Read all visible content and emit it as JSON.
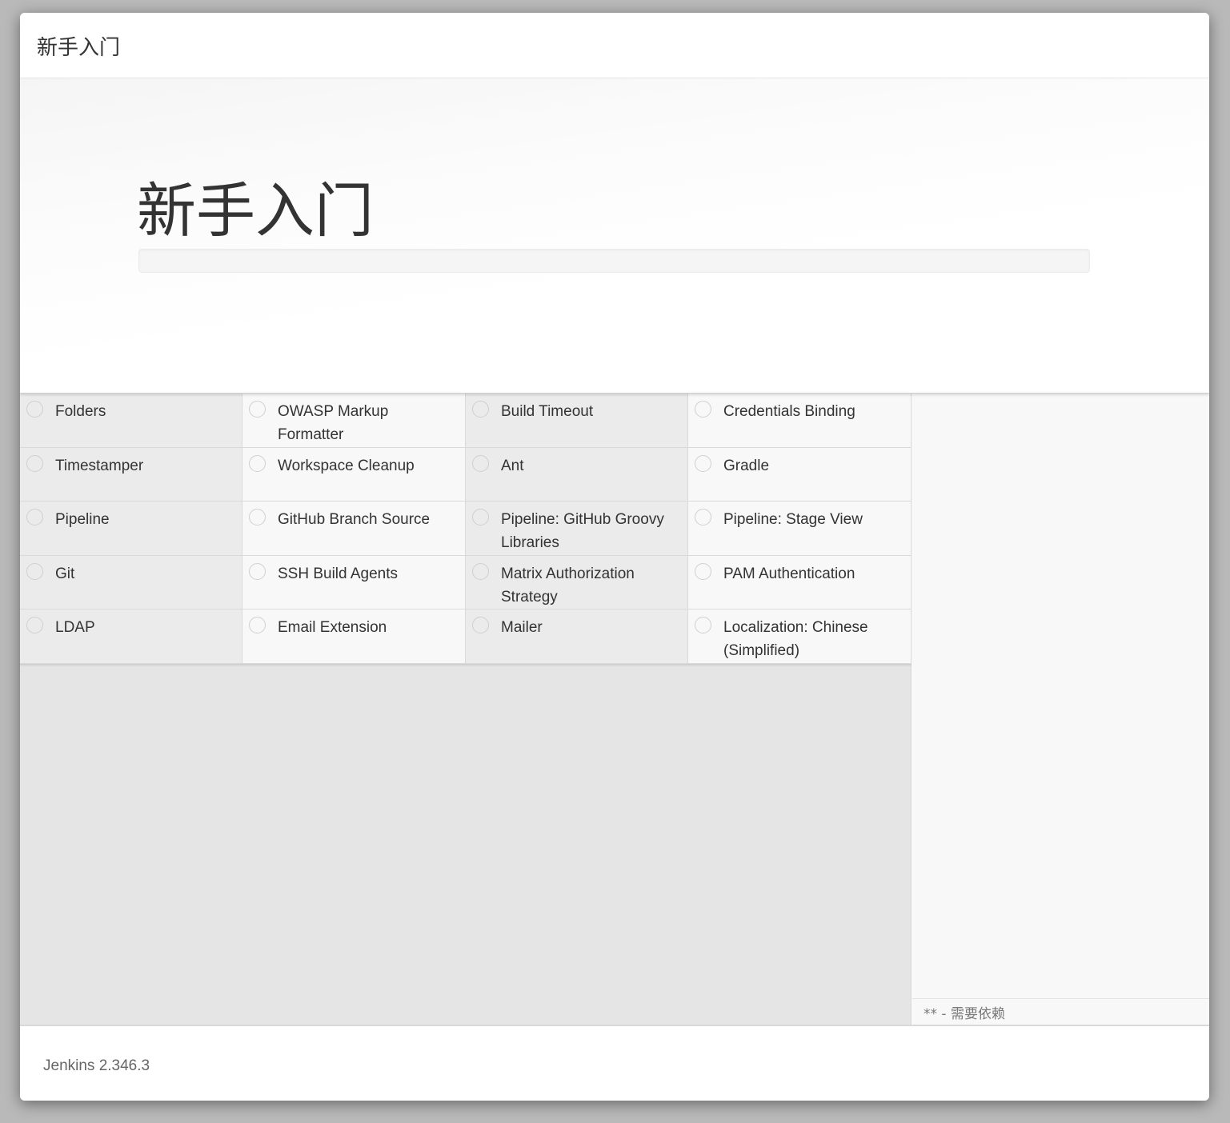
{
  "dialog": {
    "title": "新手入门"
  },
  "hero": {
    "title": "新手入门",
    "progress_percent": 0
  },
  "plugins": [
    {
      "label": "Folders",
      "shade": "a"
    },
    {
      "label": "OWASP Markup Formatter",
      "shade": "b"
    },
    {
      "label": "Build Timeout",
      "shade": "a"
    },
    {
      "label": "Credentials Binding",
      "shade": "b"
    },
    {
      "label": "Timestamper",
      "shade": "a"
    },
    {
      "label": "Workspace Cleanup",
      "shade": "b"
    },
    {
      "label": "Ant",
      "shade": "a"
    },
    {
      "label": "Gradle",
      "shade": "b"
    },
    {
      "label": "Pipeline",
      "shade": "a"
    },
    {
      "label": "GitHub Branch Source",
      "shade": "b"
    },
    {
      "label": "Pipeline: GitHub Groovy Libraries",
      "shade": "a"
    },
    {
      "label": "Pipeline: Stage View",
      "shade": "b"
    },
    {
      "label": "Git",
      "shade": "a"
    },
    {
      "label": "SSH Build Agents",
      "shade": "b"
    },
    {
      "label": "Matrix Authorization Strategy",
      "shade": "a"
    },
    {
      "label": "PAM Authentication",
      "shade": "b"
    },
    {
      "label": "LDAP",
      "shade": "a"
    },
    {
      "label": "Email Extension",
      "shade": "b"
    },
    {
      "label": "Mailer",
      "shade": "a"
    },
    {
      "label": "Localization: Chinese (Simplified)",
      "shade": "b"
    }
  ],
  "side_panel": {
    "legend": "** - 需要依赖"
  },
  "footer": {
    "version": "Jenkins 2.346.3"
  }
}
